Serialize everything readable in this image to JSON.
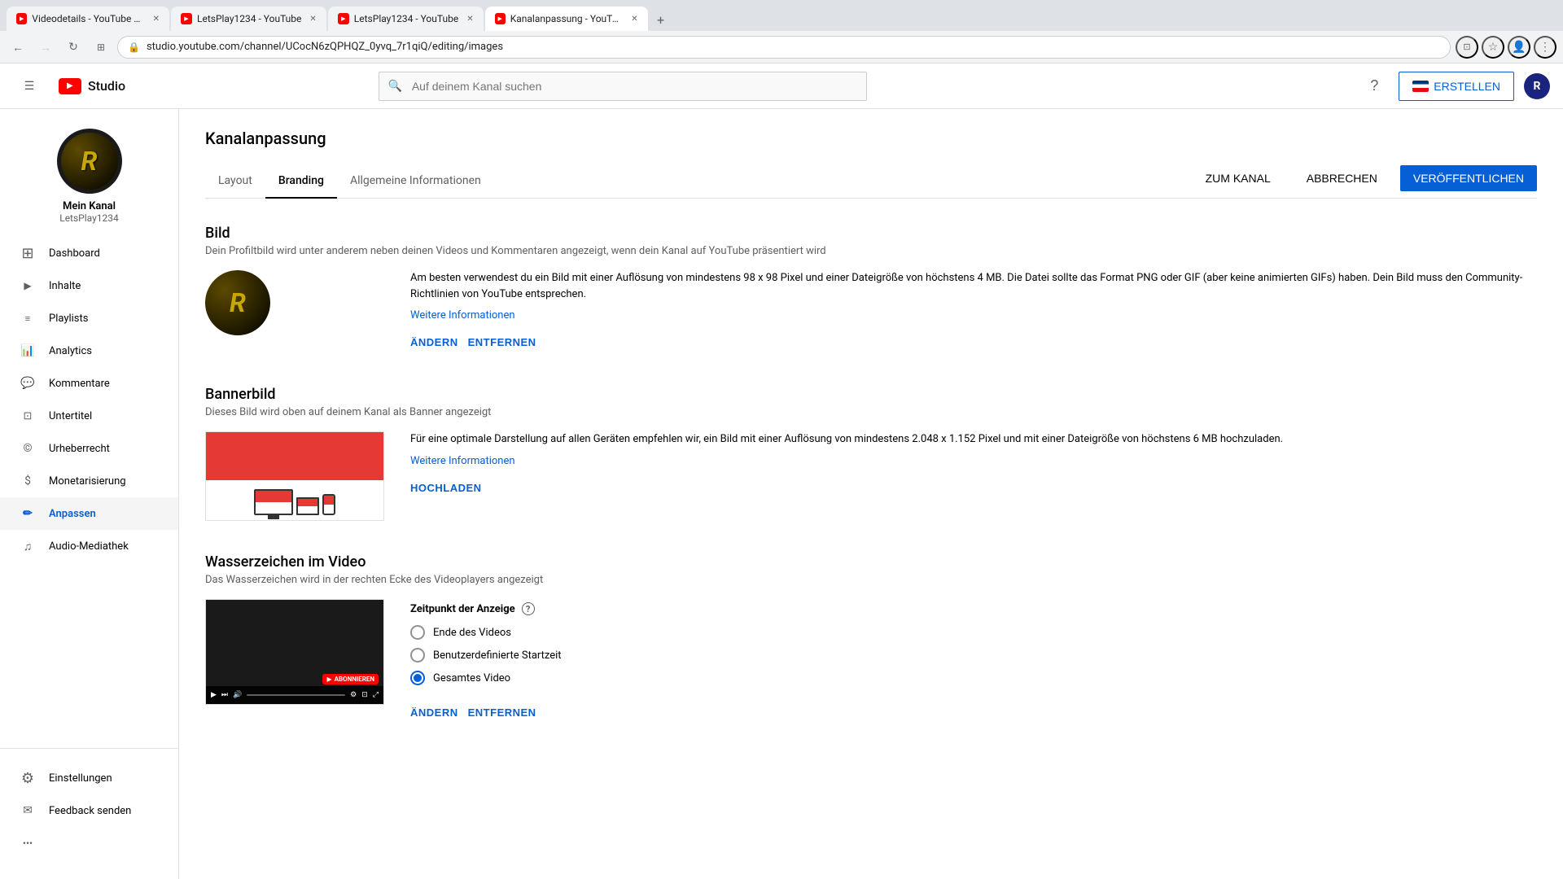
{
  "browser": {
    "tabs": [
      {
        "id": "tab1",
        "favicon": "yt",
        "title": "Videodetails - YouTube St...",
        "active": false,
        "closeable": true
      },
      {
        "id": "tab2",
        "favicon": "yt",
        "title": "LetsPlay1234 - YouTube",
        "active": false,
        "closeable": true
      },
      {
        "id": "tab3",
        "favicon": "yt",
        "title": "LetsPlay1234 - YouTube",
        "active": false,
        "closeable": true
      },
      {
        "id": "tab4",
        "favicon": "yt-studio",
        "title": "Kanalanpassung - YouTub...",
        "active": true,
        "closeable": true
      }
    ],
    "url": "studio.youtube.com/channel/UCocN6zQPHQZ_0yvq_7r1qiQ/editing/images",
    "new_tab_label": "+"
  },
  "topbar": {
    "menu_icon": "☰",
    "logo_text": "Studio",
    "search_placeholder": "Auf deinem Kanal suchen",
    "help_icon": "?",
    "create_label": "ERSTELLEN",
    "avatar_letter": "R"
  },
  "sidebar": {
    "channel_name": "Mein Kanal",
    "channel_handle": "LetsPlay1234",
    "avatar_letter": "R",
    "nav_items": [
      {
        "id": "dashboard",
        "icon": "⊞",
        "label": "Dashboard"
      },
      {
        "id": "inhalte",
        "icon": "▶",
        "label": "Inhalte"
      },
      {
        "id": "playlists",
        "icon": "☰",
        "label": "Playlists"
      },
      {
        "id": "analytics",
        "icon": "📊",
        "label": "Analytics"
      },
      {
        "id": "kommentare",
        "icon": "💬",
        "label": "Kommentare"
      },
      {
        "id": "untertitel",
        "icon": "⊡",
        "label": "Untertitel"
      },
      {
        "id": "urheberrecht",
        "icon": "©",
        "label": "Urheberrecht"
      },
      {
        "id": "monetarisierung",
        "icon": "$",
        "label": "Monetarisierung"
      },
      {
        "id": "anpassen",
        "icon": "✏",
        "label": "Anpassen",
        "active": true
      },
      {
        "id": "audio-mediathek",
        "icon": "♫",
        "label": "Audio-Mediathek"
      }
    ],
    "bottom_items": [
      {
        "id": "einstellungen",
        "icon": "⚙",
        "label": "Einstellungen"
      },
      {
        "id": "feedback",
        "icon": "✉",
        "label": "Feedback senden"
      },
      {
        "id": "more",
        "icon": "•••",
        "label": ""
      }
    ]
  },
  "page": {
    "title": "Kanalanpassung",
    "tabs": [
      {
        "id": "layout",
        "label": "Layout"
      },
      {
        "id": "branding",
        "label": "Branding",
        "active": true
      },
      {
        "id": "allgemeine",
        "label": "Allgemeine Informationen"
      }
    ],
    "actions": {
      "zum_kanal": "ZUM KANAL",
      "abbrechen": "ABBRECHEN",
      "veroeffentlichen": "VERÖFFENTLICHEN"
    }
  },
  "sections": {
    "bild": {
      "title": "Bild",
      "description": "Dein Profiltbild wird unter anderem neben deinen Videos und Kommentaren angezeigt, wenn dein Kanal auf YouTube präsentiert wird",
      "info_text": "Am besten verwendest du ein Bild mit einer Auflösung von mindestens 98 x 98 Pixel und einer Dateigröße von höchstens 4 MB. Die Datei sollte das Format PNG oder GIF (aber keine animierten GIFs) haben. Dein Bild muss den Community-Richtlinien von YouTube entsprechen.",
      "info_link": "Weitere Informationen",
      "btn_aendern": "ÄNDERN",
      "btn_entfernen": "ENTFERNEN"
    },
    "bannerbild": {
      "title": "Bannerbild",
      "description": "Dieses Bild wird oben auf deinem Kanal als Banner angezeigt",
      "info_text": "Für eine optimale Darstellung auf allen Geräten empfehlen wir, ein Bild mit einer Auflösung von mindestens 2.048 x 1.152 Pixel und mit einer Dateigröße von höchstens 6 MB hochzuladen.",
      "info_link": "Weitere Informationen",
      "btn_hochladen": "HOCHLADEN"
    },
    "wasserzeichen": {
      "title": "Wasserzeichen im Video",
      "description": "Das Wasserzeichen wird in der rechten Ecke des Videoplayers angezeigt",
      "zeitpunkt_label": "Zeitpunkt der Anzeige",
      "options": [
        {
          "id": "ende",
          "label": "Ende des Videos",
          "checked": false
        },
        {
          "id": "benutzerdefiniert",
          "label": "Benutzerdefinierte Startzeit",
          "checked": false
        },
        {
          "id": "gesamtes",
          "label": "Gesamtes Video",
          "checked": true
        }
      ],
      "btn_aendern": "ÄNDERN",
      "btn_entfernen": "ENTFERNEN"
    }
  }
}
